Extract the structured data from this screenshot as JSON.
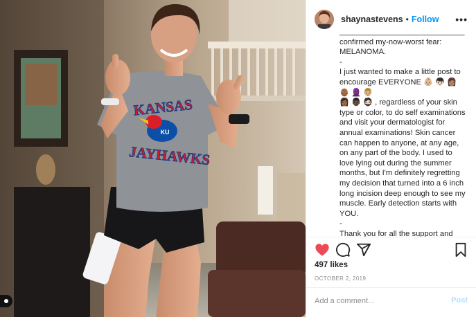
{
  "post": {
    "username": "shaynastevens",
    "separator": "•",
    "follow_label": "Follow",
    "more_label": "•••",
    "caption_text": "_____________________________\nconfirmed my-now-worst fear:\nMELANOMA.\n-\nI just wanted to make a little post to encourage EVERYONE 👶🏼 👦🏻 👩🏽 👴🏾 🧕🏿 👨🏼\n👩🏾 👨🏿 🧔🏻 , regardless of your skin type or color, to do self examinations and visit your dermatologist for annual examinations! Skin cancer can happen to anyone, at any age, on any part of the body. I used to love lying out during the summer months, but I'm definitely regretting my decision that turned into a 6 inch long incision deep enough to see my muscle. Early detection starts with YOU.\n-\nThank you for all the support and prayers. ❤️ My surgeon said the results should",
    "likes_text": "497 likes",
    "date_text": "OCTOBER 2, 2019",
    "comment_placeholder": "Add a comment...",
    "post_label": "Post"
  },
  "photo": {
    "shirt_line1": "KANSAS",
    "shirt_line2": "JAYHAWKS",
    "mascot_label": "KU"
  },
  "icons": {
    "like": "heart-icon",
    "comment": "comment-icon",
    "share": "share-icon",
    "save": "bookmark-icon",
    "more": "more-options-icon",
    "user_tag": "user-tag-icon"
  },
  "colors": {
    "like": "#ed4956",
    "follow": "#0095f6",
    "post_disabled": "#b2dffc",
    "date": "#8e8e8e"
  }
}
